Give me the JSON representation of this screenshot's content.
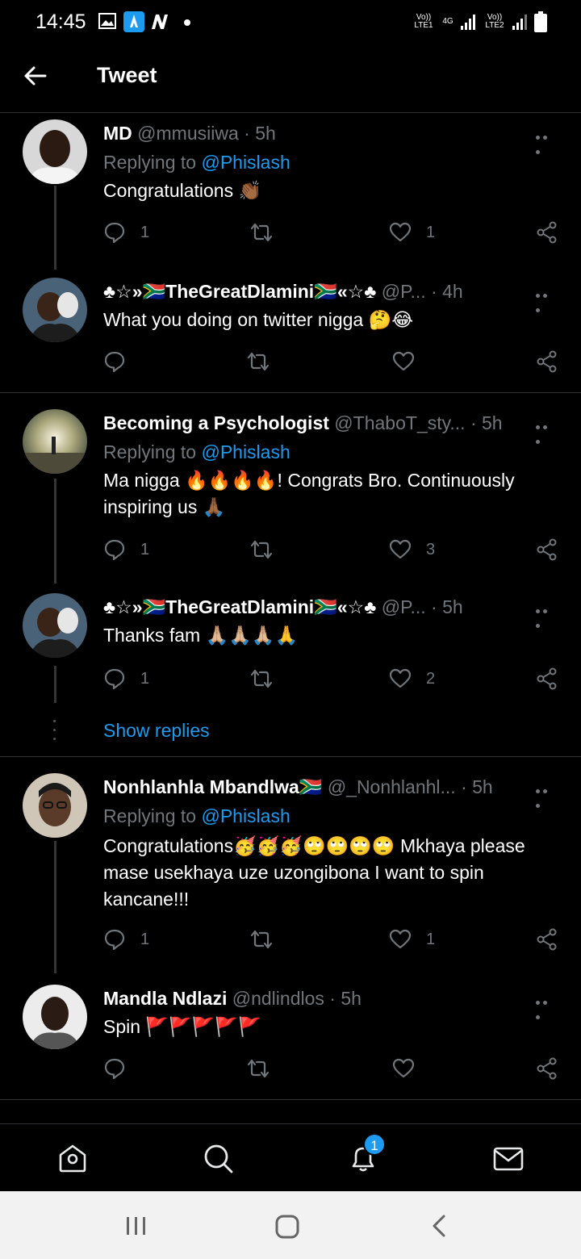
{
  "status_bar": {
    "time": "14:45",
    "network_left": "Vo)) LTE1",
    "network_type": "4G",
    "network_right": "Vo)) LTE2"
  },
  "header": {
    "title": "Tweet"
  },
  "tweets": [
    {
      "name": "MD",
      "handle": "@mmusiiwa",
      "time": "· 5h",
      "replying_label": "Replying to",
      "replying_to": "@Phislash",
      "text": "Congratulations 👏🏾",
      "reply_count": "1",
      "retweet_count": "",
      "like_count": "1"
    },
    {
      "name": "♣☆»🇿🇦TheGreatDlamini🇿🇦«☆♣",
      "handle": "@P...",
      "time": "· 4h",
      "text": "What you doing on twitter nigga 🤔😂",
      "reply_count": "",
      "retweet_count": "",
      "like_count": ""
    },
    {
      "name": "Becoming a Psychologist",
      "handle": "@ThaboT_sty...",
      "time": "· 5h",
      "replying_label": "Replying to",
      "replying_to": "@Phislash",
      "text": "Ma nigga 🔥🔥🔥🔥! Congrats Bro. Continuously inspiring us 🙏🏾",
      "reply_count": "1",
      "retweet_count": "",
      "like_count": "3"
    },
    {
      "name": "♣☆»🇿🇦TheGreatDlamini🇿🇦«☆♣",
      "handle": "@P...",
      "time": "· 5h",
      "text": "Thanks fam 🙏🏼🙏🏼🙏🏼🙏",
      "reply_count": "1",
      "retweet_count": "",
      "like_count": "2"
    },
    {
      "name": "Nonhlanhla Mbandlwa🇿🇦",
      "handle": "@_Nonhlanhl...",
      "time": "· 5h",
      "replying_label": "Replying to",
      "replying_to": "@Phislash",
      "text": "Congratulations🥳🥳🥳🙄🙄🙄🙄 Mkhaya please mase usekhaya uze uzongibona I want to spin kancane!!!",
      "reply_count": "1",
      "retweet_count": "",
      "like_count": "1"
    },
    {
      "name": "Mandla Ndlazi",
      "handle": "@ndlindlos",
      "time": "· 5h",
      "text": "Spin 🚩🚩🚩🚩🚩",
      "reply_count": "",
      "retweet_count": "",
      "like_count": ""
    }
  ],
  "show_replies": "Show replies",
  "bottom_nav": {
    "notifications_badge": "1"
  },
  "colors": {
    "accent": "#1d9bf0",
    "background": "#000000",
    "muted": "#71767b"
  }
}
